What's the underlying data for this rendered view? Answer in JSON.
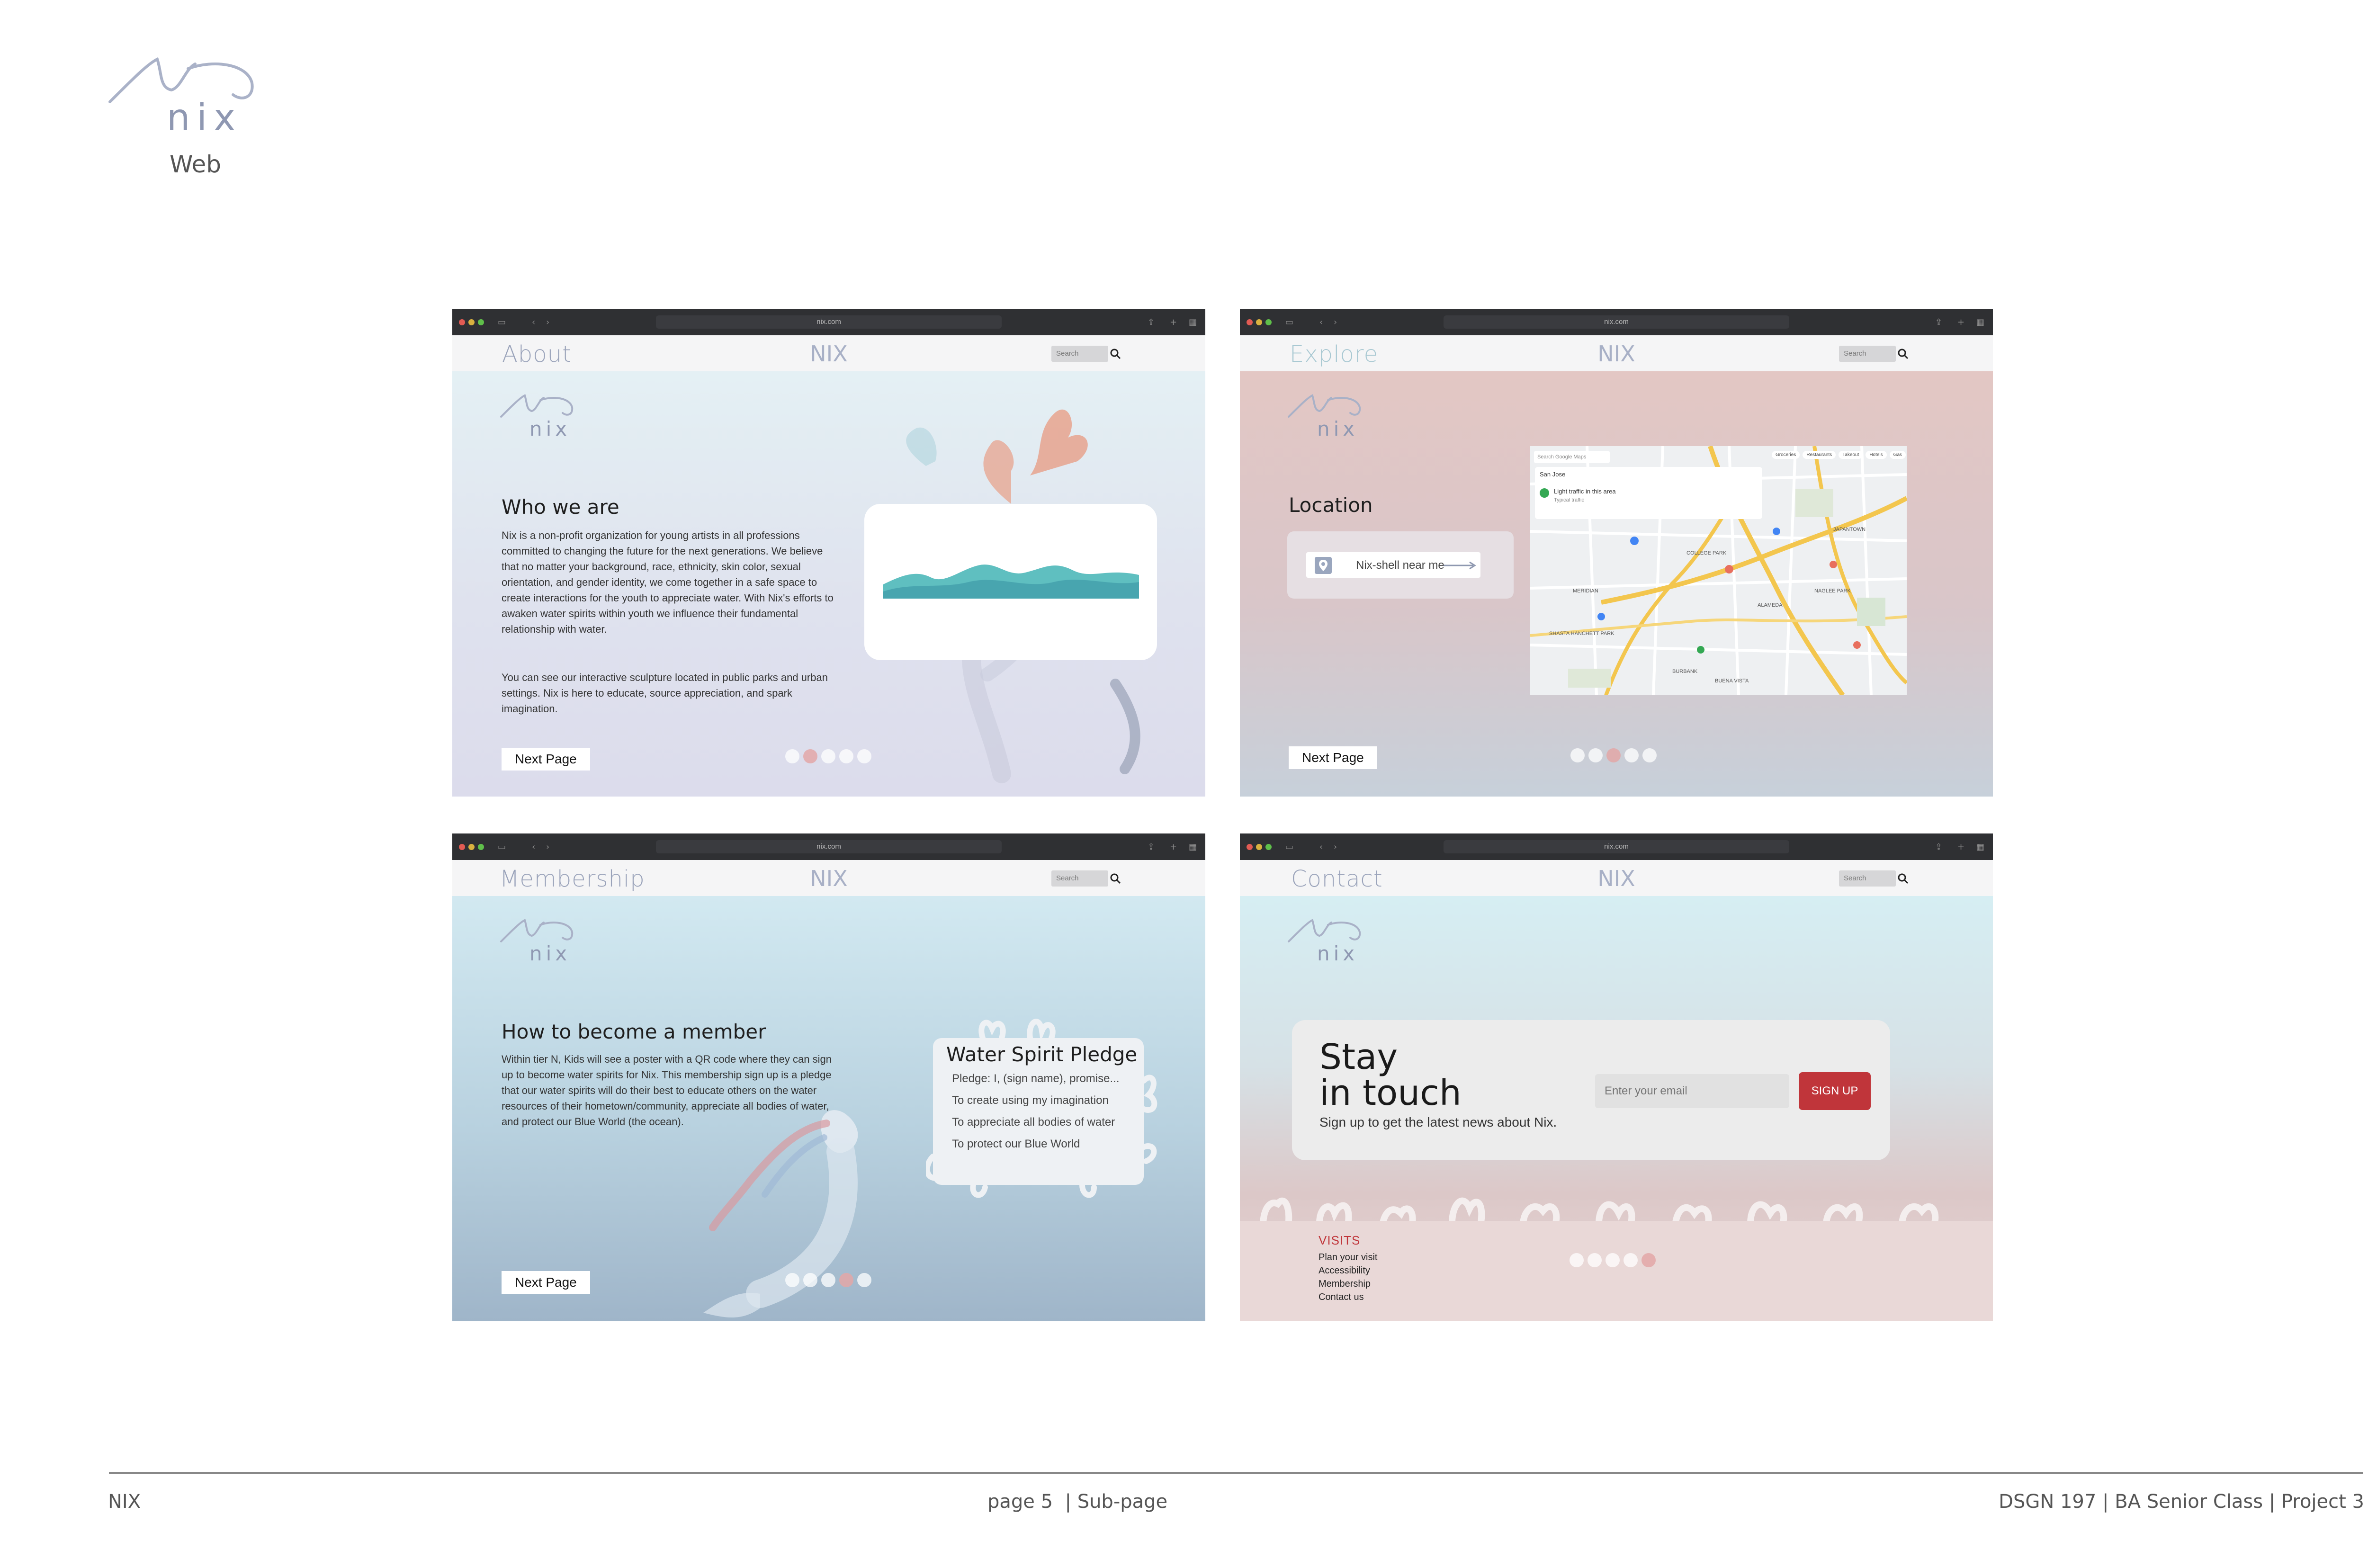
{
  "header": {
    "web_label": "Web"
  },
  "footer": {
    "left": "NIX",
    "center": "page 5  | Sub-page",
    "right": "DSGN 197 | BA Senior Class | Project 3"
  },
  "browser": {
    "url": "nix.com",
    "search_placeholder": "Search",
    "brand": "NIX"
  },
  "about": {
    "nav_title": "About",
    "heading": "Who we are",
    "body1": "Nix is a non-profit organization for young artists in all professions committed to changing the future for the next generations. We believe that no matter your background, race, ethnicity, skin color, sexual orientation, and gender identity, we come together in a safe space to create interactions for the youth to appreciate water. With Nix's efforts to awaken water spirits within youth we influence their fundamental relationship with water.",
    "body2": "You can see our interactive sculpture located in public parks and urban settings. Nix is here to educate, source appreciation, and spark imagination.",
    "next": "Next Page",
    "active_page": 2
  },
  "explore": {
    "nav_title": "Explore",
    "heading": "Location",
    "finder": "Nix-shell near me",
    "next": "Next Page",
    "active_page": 3,
    "map": {
      "search": "Search Google Maps",
      "chips": [
        "Groceries",
        "Restaurants",
        "Takeout",
        "Hotels",
        "Gas"
      ],
      "city": "San Jose",
      "traffic": "Light traffic in this area",
      "traffic_sub": "Typical traffic",
      "labels": [
        "COLLEGE PARK",
        "JAPANTOWN",
        "NAGLEE PARK",
        "BURBANK",
        "BUENA VISTA",
        "SHASTA HANCHETT PARK",
        "ALAMEDA",
        "MERIDIAN"
      ]
    }
  },
  "membership": {
    "nav_title": "Membership",
    "heading": "How to become a member",
    "body": "Within tier N, Kids will see a poster with a QR code where they can sign up to become water spirits for Nix. This membership sign up is a pledge that our water spirits will do their best to educate others on the water resources of their hometown/community, appreciate all bodies of water, and protect our Blue World (the ocean).",
    "pledge_title": "Water Spirit Pledge",
    "pledge_lines": [
      "Pledge: I, (sign name), promise...",
      "To create using my imagination",
      "To appreciate all bodies of water",
      "To protect our Blue World"
    ],
    "next": "Next Page",
    "active_page": 4
  },
  "contact": {
    "nav_title": "Contact",
    "title_line1": "Stay",
    "title_line2": "in touch",
    "subtitle": "Sign up to get the latest news about Nix.",
    "email_placeholder": "Enter your email",
    "signup": "SIGN UP",
    "visits_heading": "VISITS",
    "links": [
      "Plan your visit",
      "Accessibility",
      "Membership",
      "Contact us"
    ],
    "active_page": 5
  },
  "colors": {
    "accent_red": "#c0353a",
    "brand_gray": "#9aa3ba",
    "coral": "#e3a48f",
    "wave": "#5fbfc0"
  }
}
